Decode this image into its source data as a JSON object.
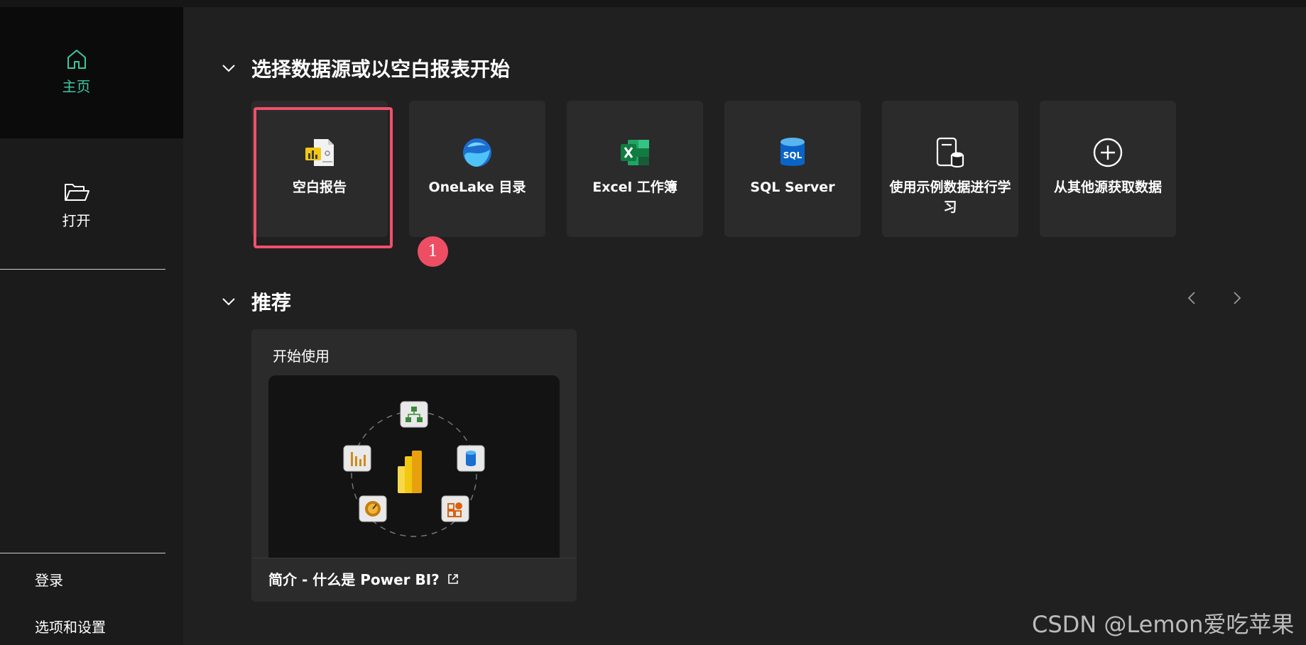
{
  "sidebar": {
    "home_label": "主页",
    "open_label": "打开",
    "signin_label": "登录",
    "settings_label": "选项和设置"
  },
  "sections": {
    "datasource_title": "选择数据源或以空白报表开始",
    "recommended_title": "推荐"
  },
  "cards": [
    {
      "label": "空白报告",
      "icon": "blank-report-icon"
    },
    {
      "label": "OneLake 目录",
      "icon": "onelake-icon"
    },
    {
      "label": "Excel 工作簿",
      "icon": "excel-icon"
    },
    {
      "label": "SQL Server",
      "icon": "sql-server-icon"
    },
    {
      "label": "使用示例数据进行学习",
      "icon": "sample-data-icon"
    },
    {
      "label": "从其他源获取数据",
      "icon": "plus-circle-icon"
    }
  ],
  "annotation": {
    "badge_text": "1",
    "color": "#f0506a"
  },
  "recommended": {
    "card_title": "开始使用",
    "link_text": "简介 - 什么是 Power BI?"
  },
  "colors": {
    "accent_green": "#3cc9a0",
    "background": "#202020",
    "card": "#2b2b2b"
  },
  "watermark": "CSDN @Lemon爱吃苹果"
}
